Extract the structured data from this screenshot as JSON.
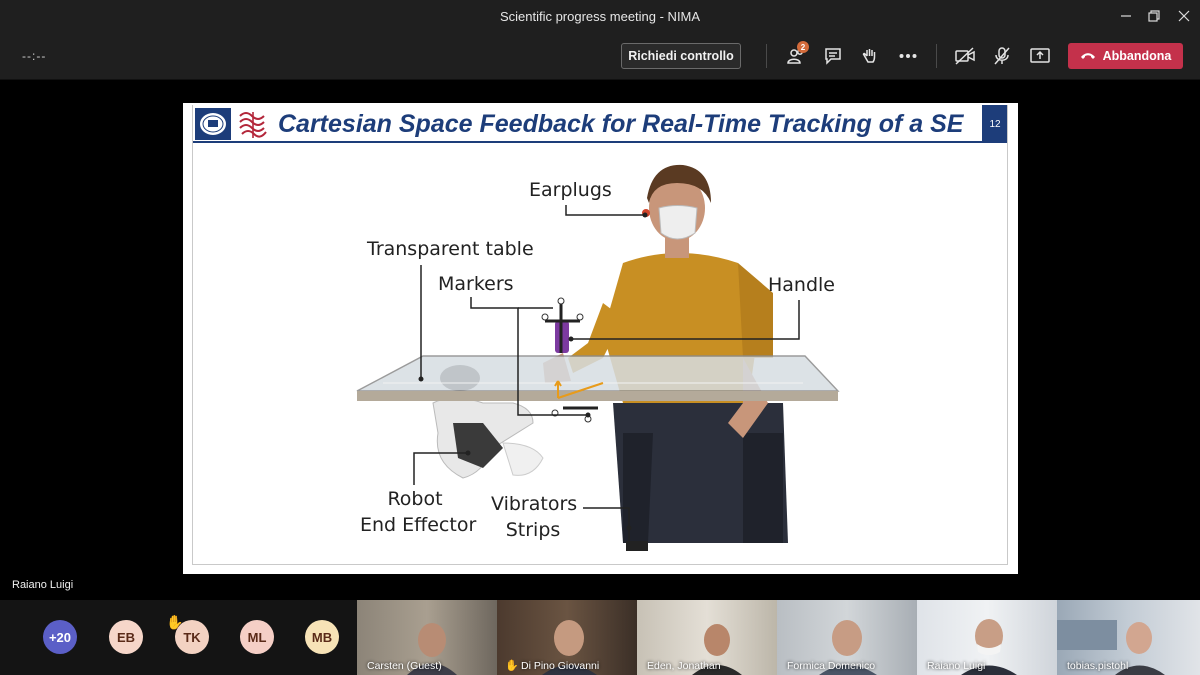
{
  "window": {
    "title": "Scientific progress meeting - NIMA"
  },
  "toolbar": {
    "timer": "--:--",
    "request_control_label": "Richiedi controllo",
    "participants_badge": "2",
    "leave_label": "Abbandona",
    "leave_color": "#c4314b"
  },
  "slide": {
    "title": "Cartesian Space Feedback for Real-Time Tracking of a SE",
    "page_number": "12",
    "title_color": "#1d3d7a",
    "labels": {
      "earplugs": "Earplugs",
      "transparent_table": "Transparent table",
      "markers": "Markers",
      "handle": "Handle",
      "robot_line1": "Robot",
      "robot_line2": "End Effector",
      "vibrators_line1": "Vibrators",
      "vibrators_line2": "Strips"
    }
  },
  "presenter": {
    "name": "Raiano Luigi"
  },
  "participants": {
    "overflow": "+20",
    "avatars": [
      {
        "initials": "EB",
        "color": "#f6d6c9"
      },
      {
        "initials": "TK",
        "color": "#f3d2c2",
        "hand_raised": true
      },
      {
        "initials": "ML",
        "color": "#f5cfc6"
      },
      {
        "initials": "MB",
        "color": "#f7e3b7"
      }
    ],
    "videos": [
      {
        "name": "Carsten (Guest)",
        "mic_icon": "mic-icon"
      },
      {
        "name": "Di Pino Giovanni",
        "hand_raised": true
      },
      {
        "name": "Eden, Jonathan"
      },
      {
        "name": "Formica Domenico"
      },
      {
        "name": "Raiano Luigi"
      },
      {
        "name": "tobias.pistohl",
        "mic_icon": "mic-icon"
      }
    ]
  }
}
